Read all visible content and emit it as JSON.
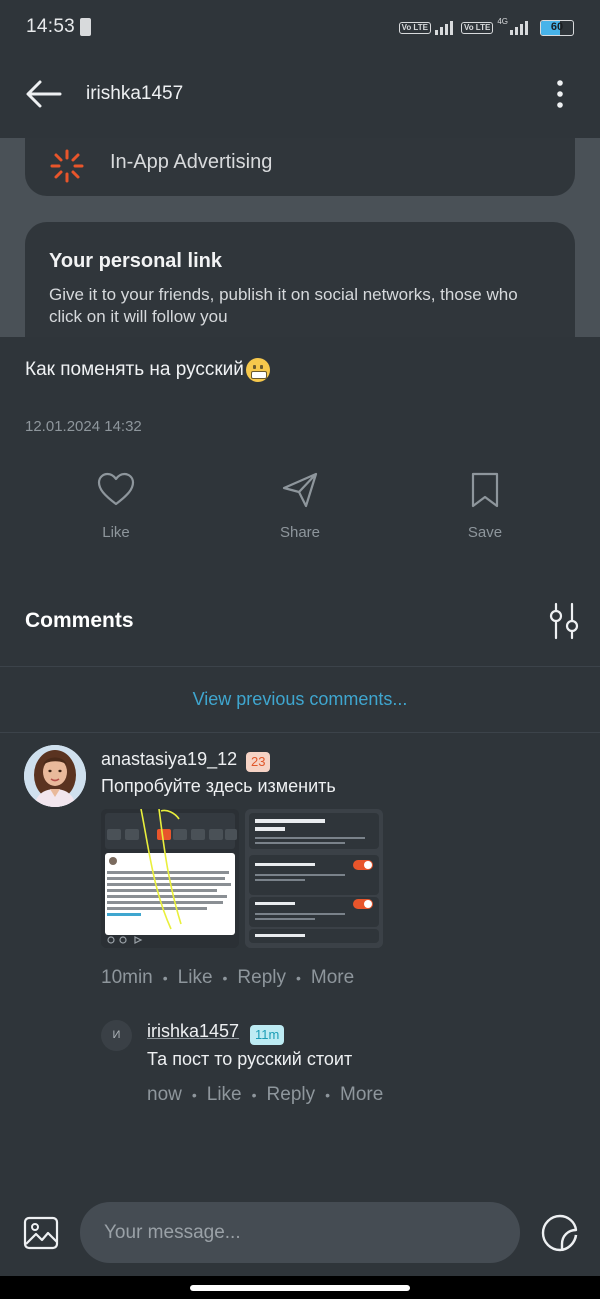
{
  "status_bar": {
    "time": "14:53",
    "volte_label": "Vo LTE",
    "network": "4G",
    "battery": "60",
    "battery_fraction": 0.6
  },
  "header": {
    "title": "irishka1457",
    "back_icon": "arrow-left-icon",
    "more_icon": "vertical-dots-icon"
  },
  "preview": {
    "ad_label": "In-App Advertising",
    "link_title": "Your personal link",
    "link_desc": "Give it to your friends, publish it on social networks, those who click on it will follow you"
  },
  "post": {
    "text": "Как поменять на русский",
    "date": "12.01.2024 14:32"
  },
  "actions": [
    {
      "label": "Like",
      "icon": "heart-icon"
    },
    {
      "label": "Share",
      "icon": "send-icon"
    },
    {
      "label": "Save",
      "icon": "bookmark-icon"
    }
  ],
  "comments": {
    "title": "Comments",
    "view_previous": "View previous comments...",
    "filter_icon": "sliders-icon",
    "items": [
      {
        "author": "anastasiya19_12",
        "badge": "23",
        "text": "Попробуйте здесь изменить",
        "time": "10min",
        "like": "Like",
        "reply": "Reply",
        "more": "More",
        "badge_color": "#e0572a",
        "reply_item": {
          "avatar_letter": "И",
          "author": "irishka1457",
          "badge": "11m",
          "text": "Та пост то русский стоит",
          "time": "now",
          "like": "Like",
          "reply": "Reply",
          "more": "More",
          "badge_color": "#1c9db6"
        }
      }
    ]
  },
  "composer": {
    "placeholder": "Your message...",
    "image_icon": "image-icon",
    "sticker_icon": "sticker-icon"
  },
  "colors": {
    "background": "#2f353a",
    "link_accent": "#3fa6cf",
    "muted_text": "#8e969c"
  }
}
